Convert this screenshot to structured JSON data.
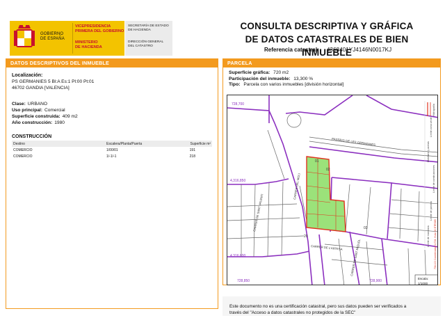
{
  "header": {
    "gov_lines": [
      "GOBIERNO",
      "DE ESPAÑA"
    ],
    "ministry_top": [
      "VICEPRESIDENCIA",
      "PRIMERA DEL GOBIERNO"
    ],
    "ministry_bottom": [
      "MINISTERIO",
      "DE HACIENDA"
    ],
    "sec_top": [
      "SECRETARÍA DE ESTADO",
      "DE HACIENDA"
    ],
    "sec_bottom": [
      "DIRECCIÓN GENERAL",
      "DEL CATASTRO"
    ],
    "title_line1": "CONSULTA DESCRIPTIVA Y GRÁFICA",
    "title_line2": "DE DATOS CATASTRALES DE BIEN INMUEBLE",
    "ref_label": "Referencia catastral:",
    "ref_value": "4368401YJ4146N0017KJ"
  },
  "left": {
    "heading": "DATOS DESCRIPTIVOS DEL INMUEBLE",
    "localizacion_label": "Localización:",
    "address_line1": "PS GERMANIES 5 Bl:A Es:1 Pl:00 Pt:01",
    "address_line2": "46702 GANDIA [VALENCIA]",
    "clase_label": "Clase:",
    "clase_value": "URBANO",
    "uso_label": "Uso principal:",
    "uso_value": "Comercial",
    "sup_label": "Superficie construida:",
    "sup_value": "409 m2",
    "anio_label": "Año construcción:",
    "anio_value": "1980",
    "construccion_heading": "CONSTRUCCIÓN",
    "table": {
      "headers": [
        "Destino",
        "Escalera/Planta/Puerta",
        "Superficie m²"
      ],
      "rows": [
        [
          "COMERCIO",
          "1/00/01",
          "191"
        ],
        [
          "COMERCIO",
          "1/-1/-1",
          "218"
        ]
      ]
    }
  },
  "right": {
    "heading": "PARCELA",
    "sup_grafica_label": "Superficie gráfica:",
    "sup_grafica_value": "720 m2",
    "participacion_label": "Participación del inmueble:",
    "participacion_value": "13,300 %",
    "tipo_label": "Tipo:",
    "tipo_value": "Parcela con varios inmuebles [división horizontal]"
  },
  "map": {
    "labels": {
      "coord_top_left": "728,700",
      "coord_mid_left": "4,316,850",
      "coord_low_left": "4,316,600",
      "coord_bot_left": "728,850",
      "coord_bot_right": "728,900",
      "street_top": "PASSEIG DE LES GERMANIES",
      "street_vert1": "CARRER DE SANT VALENTI",
      "street_vert2": "CARRER DEL MOLI",
      "street_bottom": "CARRER DE L'ARTESA",
      "street_right": "CARRER DE SANT MIQUEL",
      "parcel_01": "01",
      "parcel_02": "02",
      "parcel_03": "03",
      "parcel_20": "20",
      "scale_label": "Escala:",
      "scale_value": "1/1000"
    },
    "legend": [
      "Límite de manzana",
      "Límite de parcela",
      "Límite de construcciones",
      "Mobiliario y aceras",
      "Límite zona verde",
      "Hidrografía"
    ],
    "side_note": "734.100 Coordenadas U.T.M. Huso 30 ETRS89",
    "colors": {
      "block_line": "#8b2fbf",
      "parcel_fill": "#9be27a",
      "parcel_line": "#e0321e",
      "accent": "#f39a1e"
    }
  },
  "footnote": {
    "line1": "Este documento no es una certificación catastral, pero sus datos pueden ser verificados a",
    "line2": "través del \"Acceso a datos catastrales no protegidos de la SEC\""
  }
}
